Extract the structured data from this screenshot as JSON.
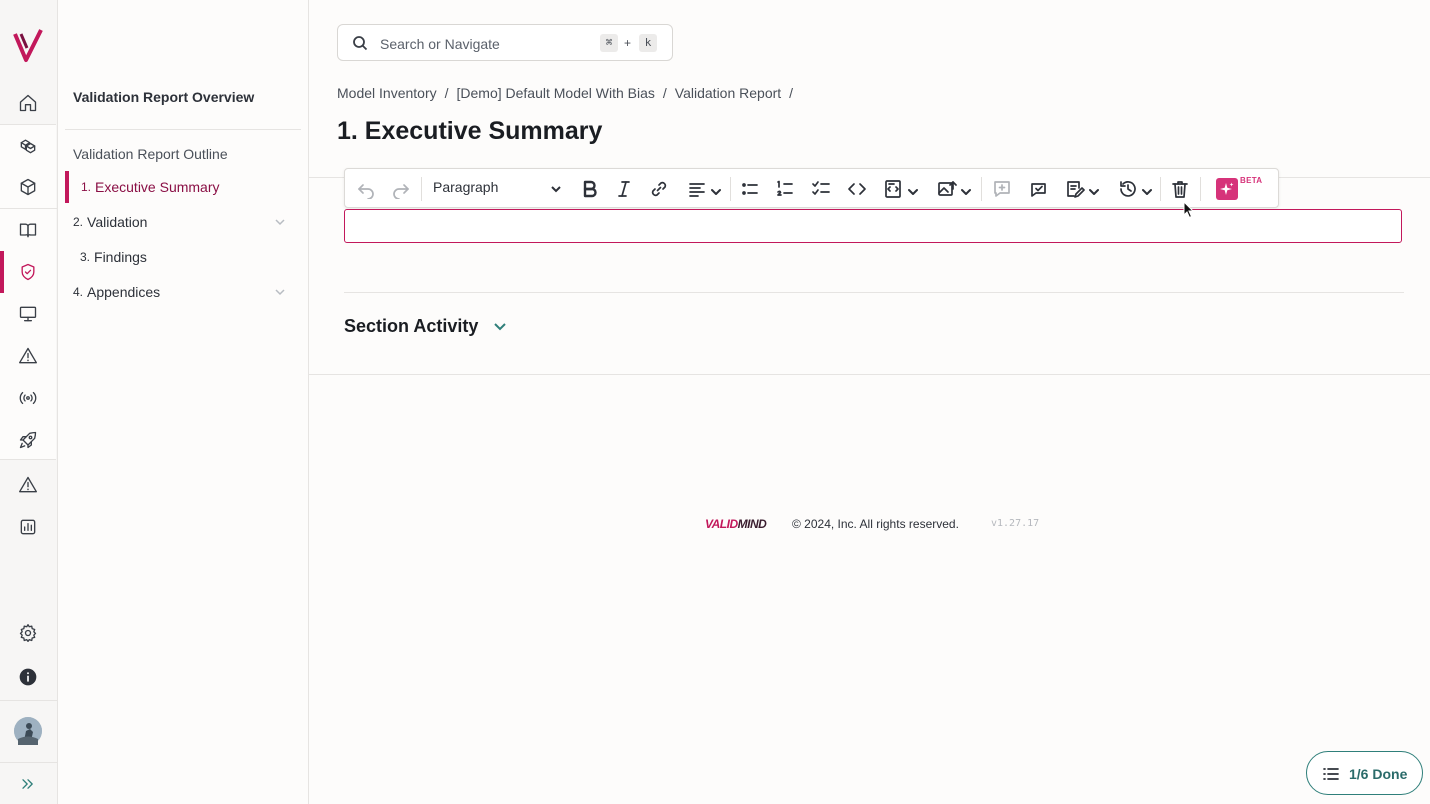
{
  "rail": {
    "icons": [
      "home-icon",
      "models-icon",
      "cube-icon",
      "book-icon",
      "shield-check-icon",
      "monitor-icon",
      "warning-icon",
      "broadcast-icon",
      "rocket-icon",
      "warning-icon",
      "chart-icon",
      "gear-icon",
      "info-icon",
      "avatar",
      "expand-icon"
    ]
  },
  "outline": {
    "overview_title": "Validation Report Overview",
    "outline_title": "Validation Report Outline",
    "items": [
      {
        "num": "1.",
        "label": "Executive Summary",
        "active": true
      },
      {
        "num": "2.",
        "label": "Validation",
        "expandable": true
      },
      {
        "num": "3.",
        "label": "Findings"
      },
      {
        "num": "4.",
        "label": "Appendices",
        "expandable": true
      }
    ]
  },
  "search": {
    "placeholder": "Search or Navigate",
    "shortcut_key1": "⌘",
    "shortcut_plus": "+",
    "shortcut_key2": "k"
  },
  "breadcrumb": [
    "Model Inventory",
    "[Demo] Default Model With Bias",
    "Validation Report"
  ],
  "breadcrumb_sep": "/",
  "page_title": "1. Executive Summary",
  "toolbar": {
    "block_style": "Paragraph",
    "beta_label": "BETA"
  },
  "section_activity": "Section Activity",
  "footer": {
    "brand_part1": "VALID",
    "brand_part2": "MIND",
    "copyright": "© 2024, Inc. All rights reserved.",
    "version": "v1.27.17"
  },
  "progress_pill": "1/6 Done",
  "colors": {
    "accent": "#c2185b",
    "teal": "#2f7f7a"
  }
}
